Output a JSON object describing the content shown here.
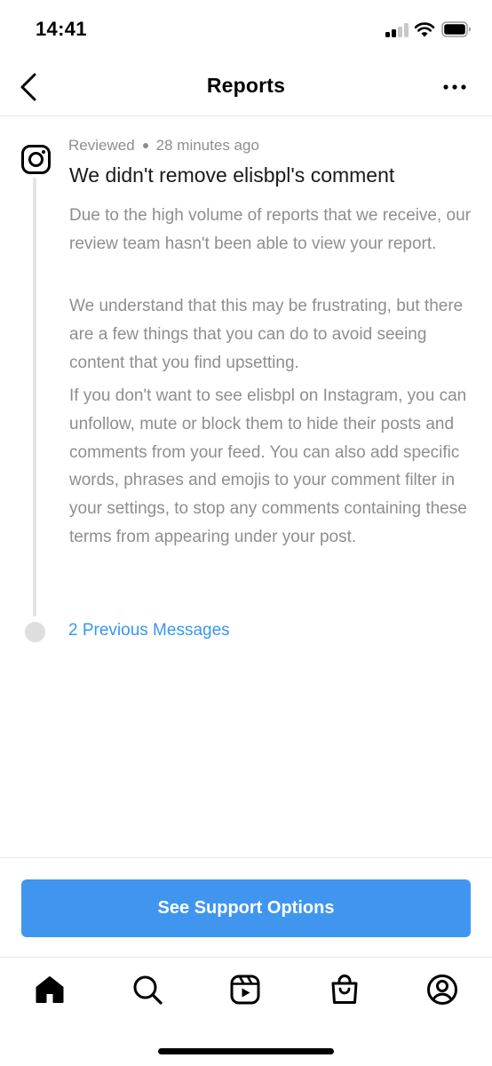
{
  "status_bar": {
    "time": "14:41"
  },
  "nav": {
    "title": "Reports"
  },
  "report": {
    "status": "Reviewed",
    "time_ago": "28 minutes ago",
    "title": "We didn't remove elisbpl's comment",
    "paragraphs": [
      "Due to the high volume of reports that we receive, our review team hasn't been able to view your report.",
      "We understand that this may be frustrating, but there are a few things that you can do to avoid seeing content that you find upsetting.",
      "If you don't want to see elisbpl on Instagram, you can unfollow, mute or block them to hide their posts and comments from your feed. You can also add specific words, phrases and emojis to your comment filter in your settings, to stop any comments containing these terms from appearing under your post."
    ],
    "previous_messages_label": "2 Previous Messages"
  },
  "support_button": {
    "label": "See Support Options"
  },
  "tabbar": {
    "items": [
      {
        "icon": "home-icon",
        "active": true
      },
      {
        "icon": "search-icon",
        "active": false
      },
      {
        "icon": "reels-icon",
        "active": false
      },
      {
        "icon": "shop-icon",
        "active": false
      },
      {
        "icon": "profile-icon",
        "active": false
      }
    ]
  },
  "colors": {
    "accent": "#3897f0",
    "button": "#4096ee",
    "secondary_text": "#8e8e8e",
    "divider": "#e6e6e6"
  }
}
